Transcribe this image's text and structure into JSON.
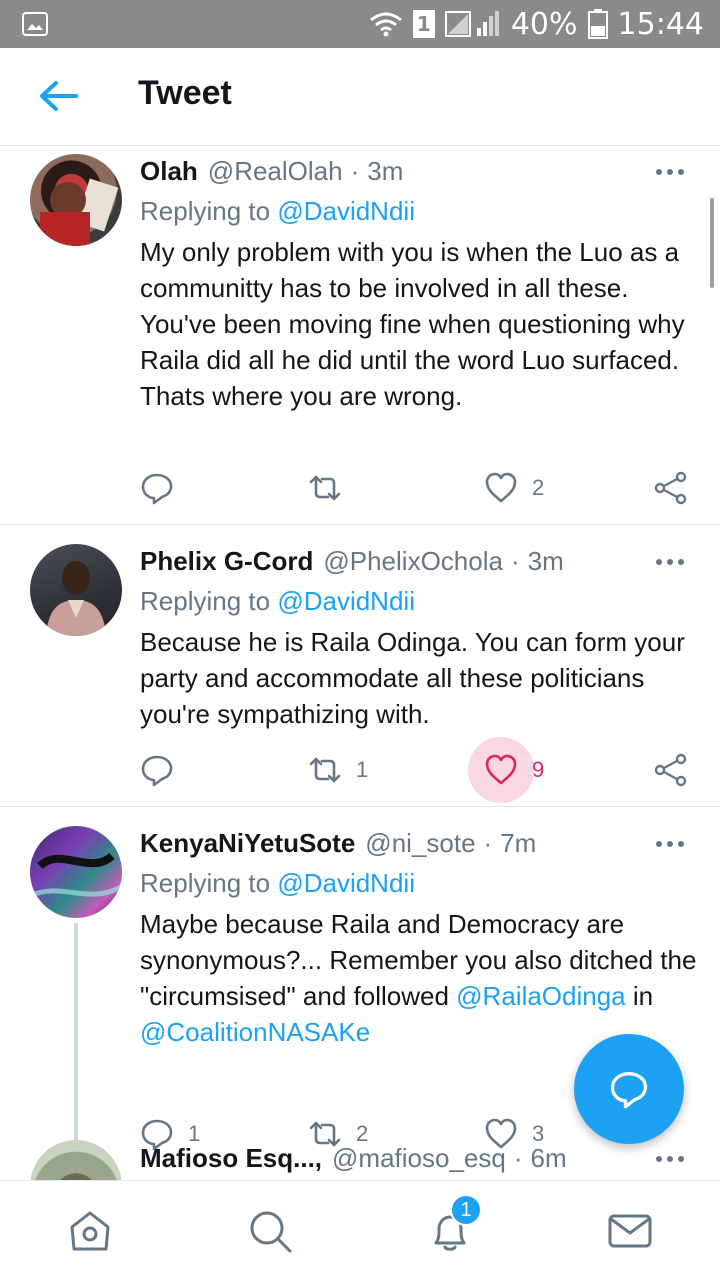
{
  "status_bar": {
    "sim": "1",
    "battery": "40%",
    "time": "15:44"
  },
  "header": {
    "title": "Tweet"
  },
  "tweets": [
    {
      "name": "Olah",
      "handle": "@RealOlah",
      "dot": "·",
      "time": "3m",
      "replying_prefix": "Replying to ",
      "replying_to": "@DavidNdii",
      "text": "My only problem with you is when the Luo as a communitty has to be involved in all these. You've been moving fine when questioning why Raila did all he did until the word Luo surfaced. Thats where you are wrong.",
      "replies": "",
      "retweets": "",
      "likes": "2"
    },
    {
      "name": "Phelix G-Cord",
      "handle": "@PhelixOchola",
      "dot": "·",
      "time": "3m",
      "replying_prefix": "Replying to ",
      "replying_to": "@DavidNdii",
      "text": "Because he is Raila Odinga. You can form your party and accommodate all these politicians you're sympathizing with.",
      "replies": "",
      "retweets": "1",
      "likes": "9"
    },
    {
      "name": "KenyaNiYetuSote",
      "handle": "@ni_sote",
      "dot": "·",
      "time": "7m",
      "replying_prefix": "Replying to ",
      "replying_to": "@DavidNdii",
      "text_part1": "Maybe because Raila and Democracy are synonymous?...  Remember you also ditched the \"circumsised\" and followed ",
      "mention1": "@RailaOdinga",
      "text_part2": " in ",
      "mention2": "@CoalitionNASAKe",
      "replies": "1",
      "retweets": "2",
      "likes": "3"
    },
    {
      "name": "Mafioso Esq...,",
      "handle": "@mafioso_esq",
      "dot": "·",
      "time": "6m"
    }
  ],
  "bottom_nav": {
    "notification_badge": "1"
  },
  "colors": {
    "accent": "#1da1f2",
    "like": "#e0245e",
    "muted": "#657786",
    "status_bar": "#8a8a8a"
  }
}
